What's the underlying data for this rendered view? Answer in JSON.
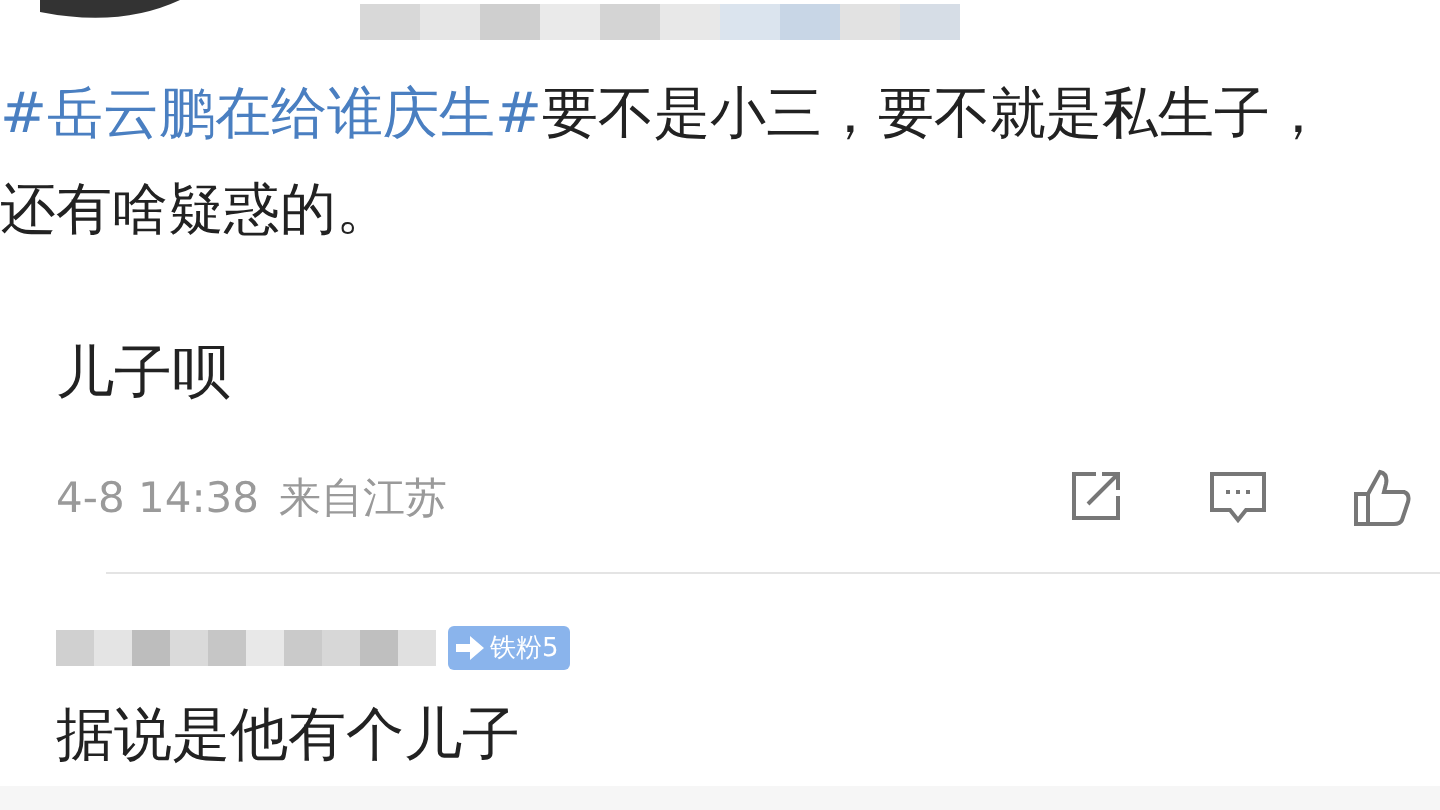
{
  "quoted_post": {
    "hashtag": "#岳云鹏在给谁庆生#",
    "text_line_1": "要不是小三，要不就是私生子，",
    "text_line_2": "还有啥疑惑的。"
  },
  "comments": [
    {
      "text": "儿子呗",
      "time": "4-8 14:38",
      "location": "来自江苏"
    },
    {
      "badge": "铁粉5",
      "text": "据说是他有个儿子"
    }
  ]
}
